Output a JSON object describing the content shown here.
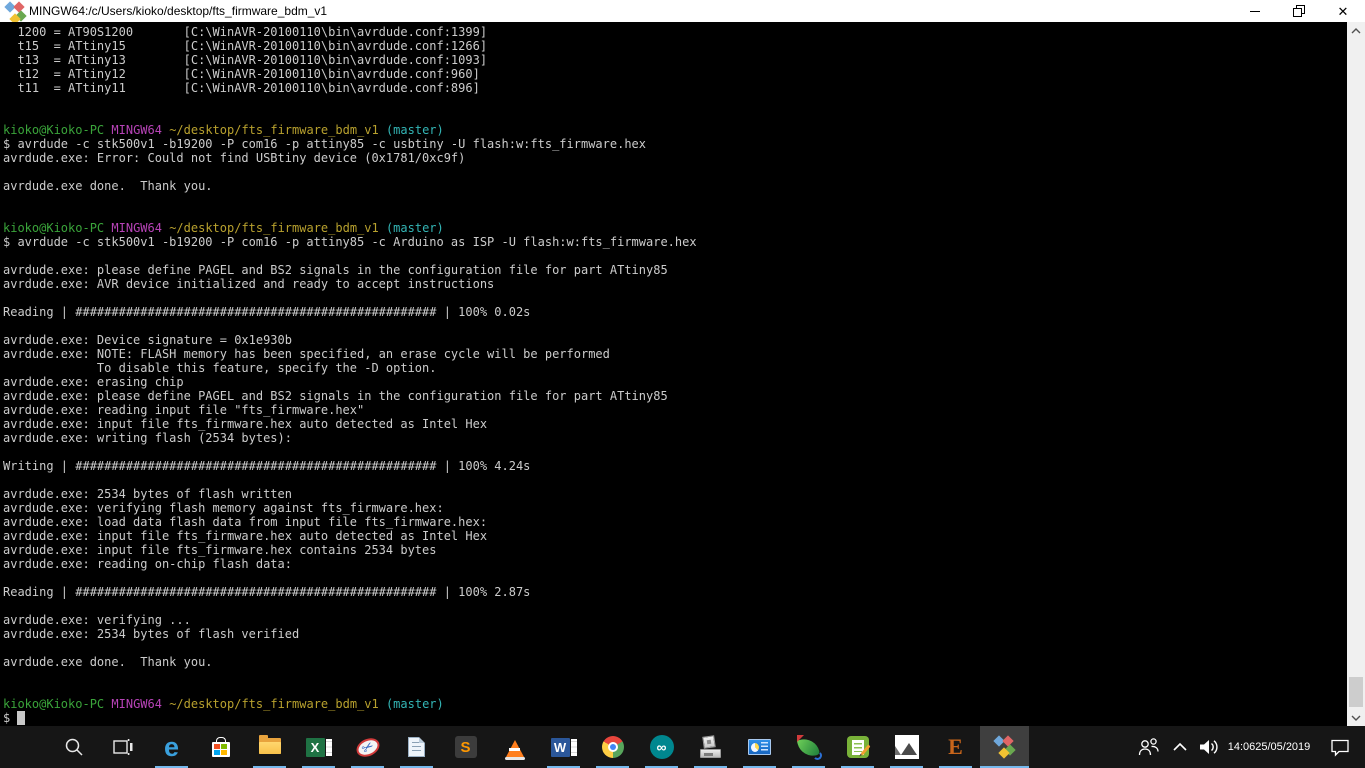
{
  "window": {
    "title": "MINGW64:/c/Users/kioko/desktop/fts_firmware_bdm_v1",
    "controls": [
      "minimize",
      "restore",
      "close"
    ],
    "app_icon": "msys-diamond-icon"
  },
  "terminal": {
    "colors": {
      "fg": "#cccccc",
      "green": "#3aa43a",
      "magenta": "#b743b7",
      "yellow": "#b8a12e",
      "cyan": "#33b5b5"
    },
    "prompt": [
      {
        "t": "kioko@Kioko-PC",
        "c": "green"
      },
      {
        "t": " "
      },
      {
        "t": "MINGW64",
        "c": "magenta"
      },
      {
        "t": " "
      },
      {
        "t": "~/desktop/fts_firmware_bdm_v1",
        "c": "yellow"
      },
      {
        "t": " "
      },
      {
        "t": "(master)",
        "c": "cyan"
      }
    ],
    "lines": [
      "  1200 = AT90S1200       [C:\\WinAVR-20100110\\bin\\avrdude.conf:1399]",
      "  t15  = ATtiny15        [C:\\WinAVR-20100110\\bin\\avrdude.conf:1266]",
      "  t13  = ATtiny13        [C:\\WinAVR-20100110\\bin\\avrdude.conf:1093]",
      "  t12  = ATtiny12        [C:\\WinAVR-20100110\\bin\\avrdude.conf:960]",
      "  t11  = ATtiny11        [C:\\WinAVR-20100110\\bin\\avrdude.conf:896]",
      "",
      "",
      "@PROMPT",
      "$ avrdude -c stk500v1 -b19200 -P com16 -p attiny85 -c usbtiny -U flash:w:fts_firmware.hex",
      "avrdude.exe: Error: Could not find USBtiny device (0x1781/0xc9f)",
      "",
      "avrdude.exe done.  Thank you.",
      "",
      "",
      "@PROMPT",
      "$ avrdude -c stk500v1 -b19200 -P com16 -p attiny85 -c Arduino as ISP -U flash:w:fts_firmware.hex",
      "",
      "avrdude.exe: please define PAGEL and BS2 signals in the configuration file for part ATtiny85",
      "avrdude.exe: AVR device initialized and ready to accept instructions",
      "",
      "Reading | ################################################## | 100% 0.02s",
      "",
      "avrdude.exe: Device signature = 0x1e930b",
      "avrdude.exe: NOTE: FLASH memory has been specified, an erase cycle will be performed",
      "             To disable this feature, specify the -D option.",
      "avrdude.exe: erasing chip",
      "avrdude.exe: please define PAGEL and BS2 signals in the configuration file for part ATtiny85",
      "avrdude.exe: reading input file \"fts_firmware.hex\"",
      "avrdude.exe: input file fts_firmware.hex auto detected as Intel Hex",
      "avrdude.exe: writing flash (2534 bytes):",
      "",
      "Writing | ################################################## | 100% 4.24s",
      "",
      "avrdude.exe: 2534 bytes of flash written",
      "avrdude.exe: verifying flash memory against fts_firmware.hex:",
      "avrdude.exe: load data flash data from input file fts_firmware.hex:",
      "avrdude.exe: input file fts_firmware.hex auto detected as Intel Hex",
      "avrdude.exe: input file fts_firmware.hex contains 2534 bytes",
      "avrdude.exe: reading on-chip flash data:",
      "",
      "Reading | ################################################## | 100% 2.87s",
      "",
      "avrdude.exe: verifying ...",
      "avrdude.exe: 2534 bytes of flash verified",
      "",
      "avrdude.exe done.  Thank you.",
      "",
      "",
      "@PROMPT",
      "@CURSORLINE"
    ],
    "cursor_line_prefix": "$ "
  },
  "scrollbar": {
    "up_arrow": "chevron-up",
    "down_arrow": "chevron-down"
  },
  "taskbar": {
    "accent_underline": "#76b9ed",
    "items": [
      {
        "icon": "windows-start",
        "running": false,
        "active": false
      },
      {
        "icon": "search",
        "running": false,
        "active": false
      },
      {
        "icon": "task-view",
        "running": false,
        "active": false
      },
      {
        "icon": "edge",
        "running": true,
        "active": false
      },
      {
        "icon": "microsoft-store",
        "running": false,
        "active": false
      },
      {
        "icon": "file-explorer",
        "running": true,
        "active": false
      },
      {
        "icon": "excel",
        "running": true,
        "active": false
      },
      {
        "icon": "snipping-tool",
        "running": true,
        "active": false
      },
      {
        "icon": "notepad",
        "running": true,
        "active": false
      },
      {
        "icon": "sublime-text",
        "running": false,
        "active": false
      },
      {
        "icon": "vlc",
        "running": false,
        "active": false
      },
      {
        "icon": "word",
        "running": true,
        "active": false
      },
      {
        "icon": "chrome",
        "running": true,
        "active": false
      },
      {
        "icon": "arduino",
        "running": true,
        "active": false
      },
      {
        "icon": "3d-printer",
        "running": true,
        "active": false
      },
      {
        "icon": "system-monitor",
        "running": true,
        "active": false
      },
      {
        "icon": "idm",
        "running": true,
        "active": false
      },
      {
        "icon": "notepad-plus-plus",
        "running": true,
        "active": false
      },
      {
        "icon": "photos",
        "running": true,
        "active": false
      },
      {
        "icon": "eagle",
        "running": true,
        "active": false
      },
      {
        "icon": "git-bash",
        "running": true,
        "active": true
      }
    ],
    "tray": {
      "icons": [
        "people",
        "chevron-up",
        "volume",
        "action-center"
      ],
      "time": "14:06",
      "date": "25/05/2019"
    }
  }
}
